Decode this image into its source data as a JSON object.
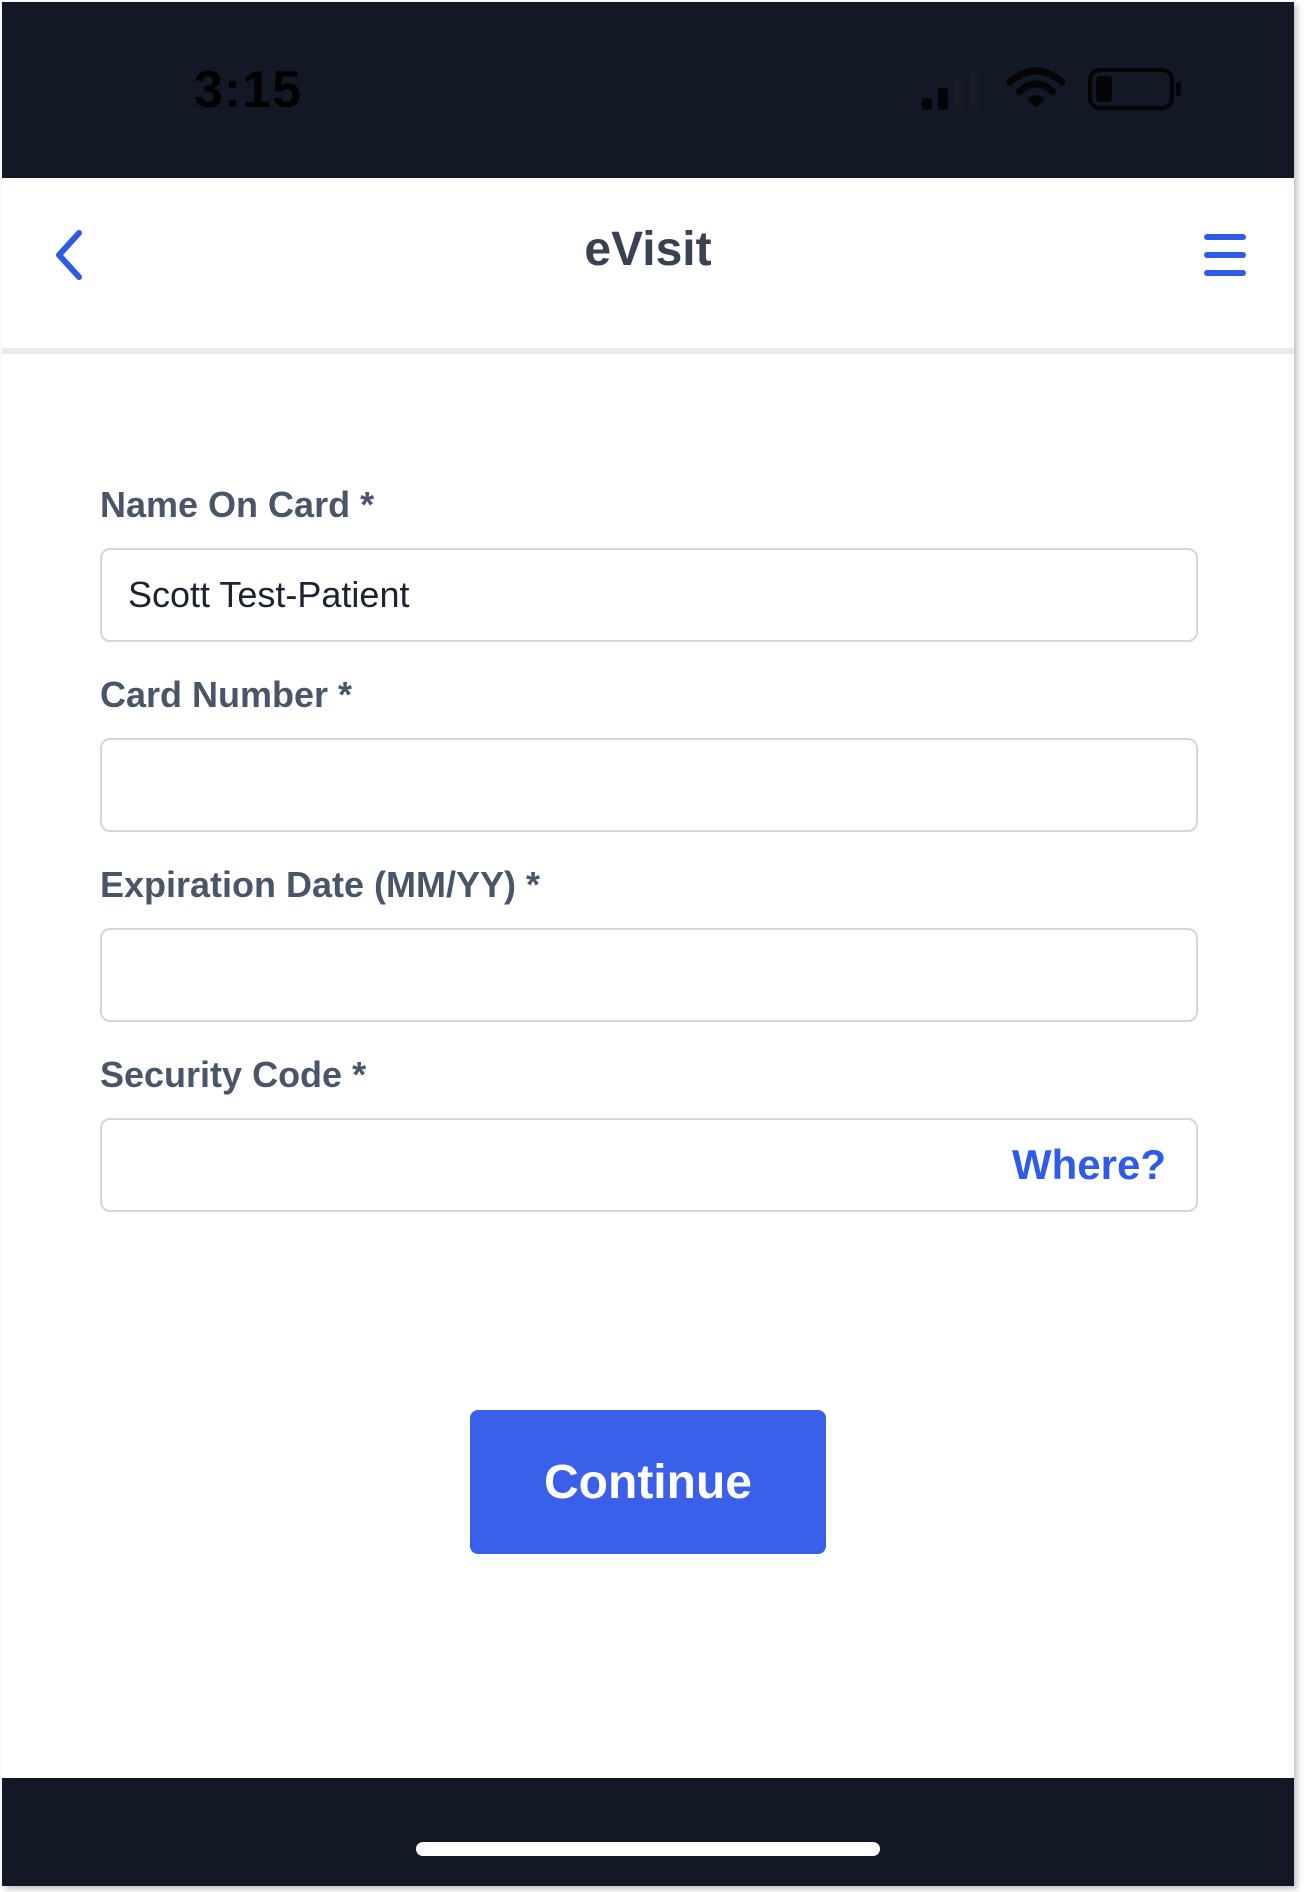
{
  "status_bar": {
    "time": "3:15",
    "icons": [
      "cellular-signal-icon",
      "wifi-icon",
      "battery-icon"
    ]
  },
  "header": {
    "title": "eVisit",
    "back_icon": "chevron-left-icon",
    "menu_icon": "hamburger-menu-icon"
  },
  "form": {
    "name_on_card": {
      "label": "Name On Card *",
      "value": "Scott Test-Patient"
    },
    "card_number": {
      "label": "Card Number *",
      "value": ""
    },
    "expiration_date": {
      "label": "Expiration Date (MM/YY) *",
      "value": ""
    },
    "security_code": {
      "label": "Security Code *",
      "value": "",
      "help_link": "Where?"
    }
  },
  "actions": {
    "continue_label": "Continue"
  },
  "colors": {
    "accent": "#3a60ea",
    "link": "#2f5be8",
    "system_bar": "#121826",
    "label_text": "#4a5668",
    "input_border": "#d4d6dc"
  }
}
